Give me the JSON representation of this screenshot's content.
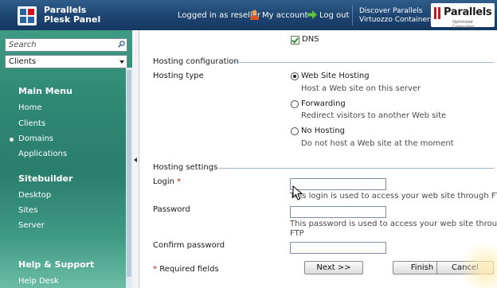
{
  "header": {
    "product_line1": "Parallels",
    "product_line2": "Plesk Panel",
    "logged_in": "Logged in as reseller",
    "my_account": "My account",
    "log_out": "Log out",
    "discover_line1": "Discover Parallels",
    "discover_line2": "Virtuozzo Containers",
    "brand_name": "Parallels",
    "brand_tagline": "Optimized Computing",
    "colors": {
      "header_bg": "#1d4470",
      "brand_red": "#d3111b"
    },
    "icons": [
      "plesk-logo-icon",
      "user-icon",
      "logout-arrow-icon",
      "parallels-logo-icon"
    ]
  },
  "sidebar": {
    "search_placeholder": "Search",
    "context_select": "Clients",
    "main_menu_heading": "Main Menu",
    "main_menu_items": [
      "Home",
      "Clients",
      "Domains",
      "Applications"
    ],
    "active_item": "Domains",
    "sitebuilder_heading": "Sitebuilder",
    "sitebuilder_items": [
      "Desktop",
      "Sites",
      "Server"
    ],
    "help_heading": "Help & Support",
    "help_items": [
      "Help Desk"
    ]
  },
  "form": {
    "dns_label": "DNS",
    "dns_checked": true,
    "hosting_config_heading": "Hosting configuration",
    "hosting_type_label": "Hosting type",
    "options": [
      {
        "label": "Web Site Hosting",
        "description": "Host a Web site on this server",
        "selected": true
      },
      {
        "label": "Forwarding",
        "description": "Redirect visitors to another Web site",
        "selected": false
      },
      {
        "label": "No Hosting",
        "description": "Do not host a Web site at the moment",
        "selected": false
      }
    ],
    "hosting_settings_heading": "Hosting settings",
    "login_label": "Login",
    "required_marker": "*",
    "login_value": "",
    "login_hint": "This login is used to access your web site through FTP",
    "password_label": "Password",
    "password_hint_line1": "This password is used to access your web site through",
    "password_hint_line2": "FTP",
    "confirm_password_label": "Confirm password",
    "required_fields_note": "Required fields"
  },
  "buttons": {
    "next": "Next >>",
    "finish": "Finish",
    "cancel": "Cancel"
  }
}
